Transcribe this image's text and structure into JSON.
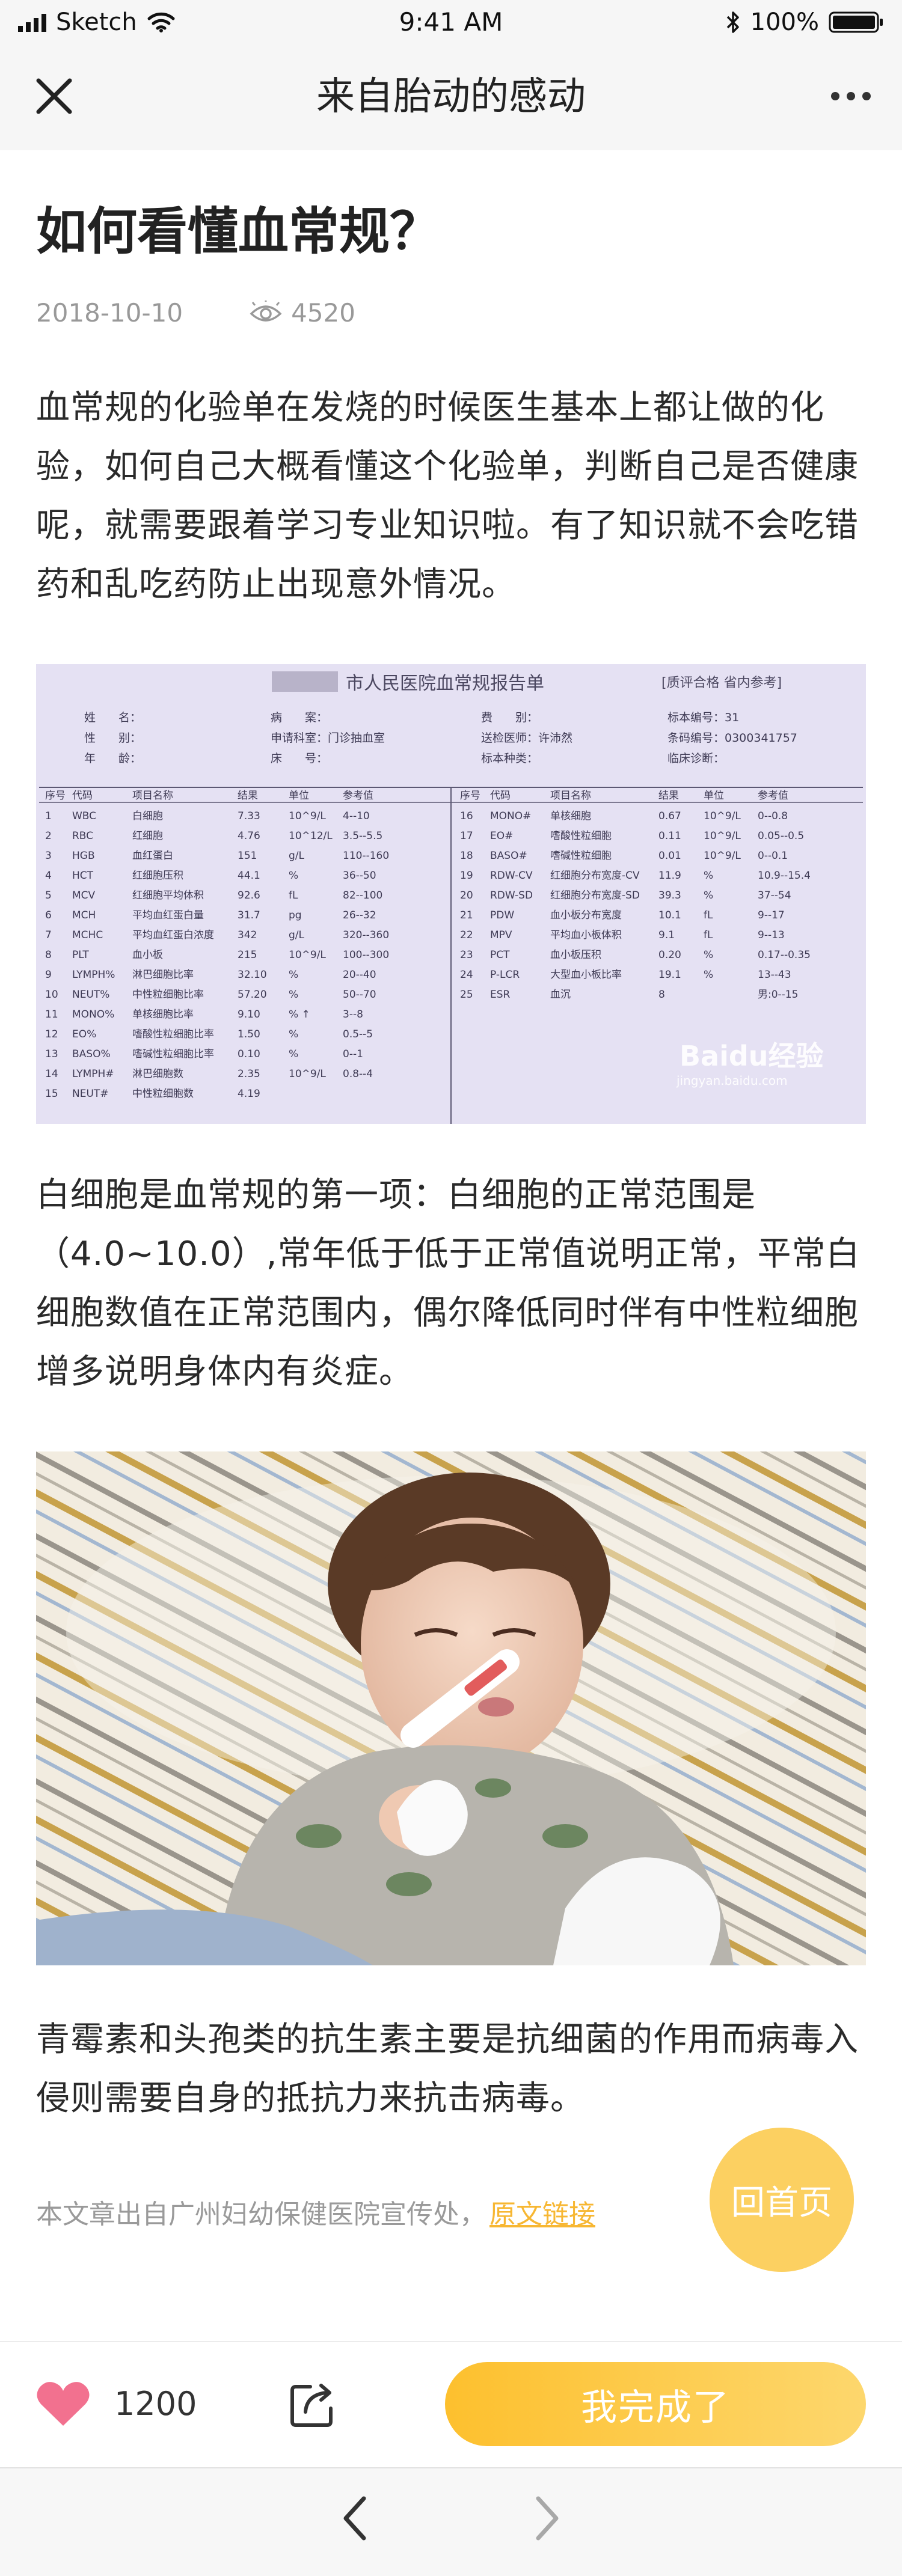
{
  "status_bar": {
    "carrier": "Sketch",
    "time": "9:41 AM",
    "battery": "100%"
  },
  "nav": {
    "title": "来自胎动的感动",
    "close_icon": "close-icon",
    "more_icon": "more-icon"
  },
  "article": {
    "title": "如何看懂血常规？",
    "date": "2018-10-10",
    "views": "4520",
    "paragraphs": [
      "血常规的化验单在发烧的时候医生基本上都让做的化验，如何自己大概看懂这个化验单，判断自己是否健康呢，就需要跟着学习专业知识啦。有了知识就不会吃错药和乱吃药防止出现意外情况。",
      "白细胞是血常规的第一项：白细胞的正常范围是（4.0~10.0）,常年低于低于正常值说明正常，平常白细胞数值在正常范围内，偶尔降低同时伴有中性粒细胞增多说明身体内有炎症。",
      "青霉素和头孢类的抗生素主要是抗细菌的作用而病毒入侵则需要自身的抵抗力来抗击病毒。"
    ],
    "source_text": "本文章出自广州妇幼保健医院宣传处，",
    "source_link": "原文链接"
  },
  "report": {
    "title": "市人民医院血常规报告单",
    "stamp": "[质评合格 省内参考]",
    "watermark": "Baidu经验",
    "watermark_url": "jingyan.baidu.com",
    "header_rows": [
      [
        "姓　　名：",
        "病　　案：",
        "费　　别：",
        "标本编号：31"
      ],
      [
        "性　　别：",
        "申请科室：门诊抽血室",
        "送检医师：许沛然",
        "条码编号：0300341757"
      ],
      [
        "年　　龄：",
        "床　　号：",
        "标本种类：",
        "临床诊断："
      ]
    ],
    "columns": [
      "序号",
      "代码",
      "项目名称",
      "结果",
      "单位",
      "参考值"
    ],
    "left_rows": [
      [
        "1",
        "WBC",
        "白细胞",
        "7.33",
        "10^9/L",
        "4--10"
      ],
      [
        "2",
        "RBC",
        "红细胞",
        "4.76",
        "10^12/L",
        "3.5--5.5"
      ],
      [
        "3",
        "HGB",
        "血红蛋白",
        "151",
        "g/L",
        "110--160"
      ],
      [
        "4",
        "HCT",
        "红细胞压积",
        "44.1",
        "%",
        "36--50"
      ],
      [
        "5",
        "MCV",
        "红细胞平均体积",
        "92.6",
        "fL",
        "82--100"
      ],
      [
        "6",
        "MCH",
        "平均血红蛋白量",
        "31.7",
        "pg",
        "26--32"
      ],
      [
        "7",
        "MCHC",
        "平均血红蛋白浓度",
        "342",
        "g/L",
        "320--360"
      ],
      [
        "8",
        "PLT",
        "血小板",
        "215",
        "10^9/L",
        "100--300"
      ],
      [
        "9",
        "LYMPH%",
        "淋巴细胞比率",
        "32.10",
        "%",
        "20--40"
      ],
      [
        "10",
        "NEUT%",
        "中性粒细胞比率",
        "57.20",
        "%",
        "50--70"
      ],
      [
        "11",
        "MONO%",
        "单核细胞比率",
        "9.10",
        "% ↑",
        "3--8"
      ],
      [
        "12",
        "EO%",
        "嗜酸性粒细胞比率",
        "1.50",
        "%",
        "0.5--5"
      ],
      [
        "13",
        "BASO%",
        "嗜碱性粒细胞比率",
        "0.10",
        "%",
        "0--1"
      ],
      [
        "14",
        "LYMPH#",
        "淋巴细胞数",
        "2.35",
        "10^9/L",
        "0.8--4"
      ],
      [
        "15",
        "NEUT#",
        "中性粒细胞数",
        "4.19",
        "",
        ""
      ]
    ],
    "right_rows": [
      [
        "16",
        "MONO#",
        "单核细胞",
        "0.67",
        "10^9/L",
        "0--0.8"
      ],
      [
        "17",
        "EO#",
        "嗜酸性粒细胞",
        "0.11",
        "10^9/L",
        "0.05--0.5"
      ],
      [
        "18",
        "BASO#",
        "嗜碱性粒细胞",
        "0.01",
        "10^9/L",
        "0--0.1"
      ],
      [
        "19",
        "RDW-CV",
        "红细胞分布宽度-CV",
        "11.9",
        "%",
        "10.9--15.4"
      ],
      [
        "20",
        "RDW-SD",
        "红细胞分布宽度-SD",
        "39.3",
        "%",
        "37--54"
      ],
      [
        "21",
        "PDW",
        "血小板分布宽度",
        "10.1",
        "fL",
        "9--17"
      ],
      [
        "22",
        "MPV",
        "平均血小板体积",
        "9.1",
        "fL",
        "9--13"
      ],
      [
        "23",
        "PCT",
        "血小板压积",
        "0.20",
        "%",
        "0.17--0.35"
      ],
      [
        "24",
        "P-LCR",
        "大型血小板比率",
        "19.1",
        "%",
        "13--43"
      ],
      [
        "25",
        "ESR",
        "血沉",
        "8",
        "",
        "男:0--15"
      ]
    ]
  },
  "floating": {
    "home_label": "回首页"
  },
  "actions": {
    "like_count": "1200",
    "done_label": "我完成了",
    "like_icon": "heart-icon",
    "share_icon": "share-icon"
  },
  "colors": {
    "accent": "#fdc02e",
    "heart": "#f2718f",
    "link": "#f7b733",
    "muted": "#999999"
  }
}
